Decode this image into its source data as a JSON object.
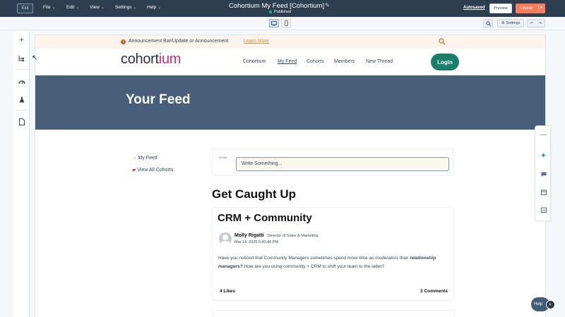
{
  "editor": {
    "exit_label": "Exit",
    "menus": [
      "File",
      "Edit",
      "View",
      "Settings",
      "Help"
    ],
    "page_title": "Cohortium My Feed [Cohortium]",
    "status": "Published",
    "autosaved": "Autosaved",
    "preview_label": "Preview",
    "update_label": "Update",
    "settings_label": "Settings"
  },
  "site": {
    "announcement": {
      "text": "Announcement Bar/Update or Announcement",
      "link": "Learn More"
    },
    "logo": {
      "main": "cohort",
      "accent": "ium"
    },
    "nav": [
      "Cohortium",
      "My Feed",
      "Cohorts",
      "Members",
      "New Thread"
    ],
    "login_label": "Login",
    "hero_title": "Your Feed",
    "sidebar": {
      "my_feed": "My Feed",
      "all_cohorts": "View All Cohorts"
    },
    "compose": {
      "avatar_alt": "HS Attr",
      "placeholder": "Write Something..."
    },
    "section_title": "Get Caught Up",
    "post": {
      "title": "CRM + Community",
      "author": "Molly Rigatti",
      "role": "Director of Sales & Marketing",
      "date": "Mar 14, 2025 5:43:46 PM",
      "body_1": "Have you noticed that Community Managers sometimes spend more time as ",
      "body_em": "moderators",
      "body_2": " than ",
      "body_strong": "relationship managers?",
      "body_3": " How are you using community + CRM to shift your team to the latter?",
      "likes": "4 Likes",
      "comments": "3 Comments"
    }
  },
  "help_label": "Help",
  "colors": {
    "topbar": "#2d3e50",
    "accent_orange": "#ff7a59",
    "hero": "#475f78",
    "login": "#1a7e6a",
    "logo_accent": "#d4287a"
  }
}
